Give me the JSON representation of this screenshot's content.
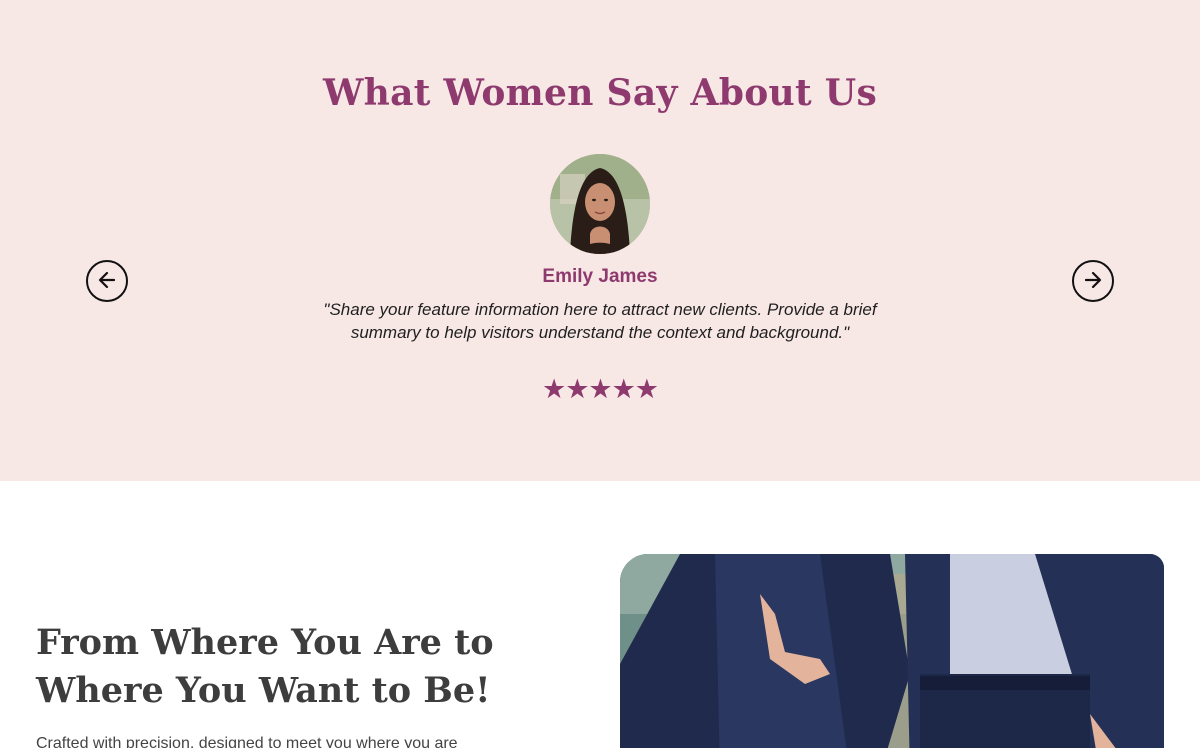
{
  "testimonials": {
    "heading": "What Women Say About Us",
    "prev_icon": "arrow-left-icon",
    "next_icon": "arrow-right-icon",
    "current": {
      "name": "Emily James",
      "quote": "\"Share your feature information here to attract new clients. Provide a brief summary to help visitors understand the context and background.\"",
      "rating": 5,
      "rating_display": "★★★★★"
    }
  },
  "journey": {
    "heading": "From Where You Are to Where You Want to Be!",
    "body": "Crafted with precision, designed to meet you where you are"
  },
  "colors": {
    "accent": "#8e3a6e",
    "testimonial_bg": "#f7e8e6",
    "heading_dark": "#3d3d3d"
  }
}
